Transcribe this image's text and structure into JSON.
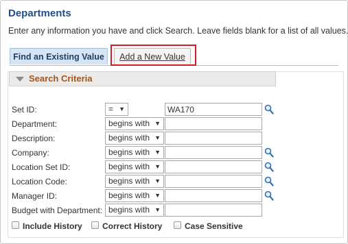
{
  "page": {
    "title": "Departments",
    "instructions": "Enter any information you have and click Search. Leave fields blank for a list of all values."
  },
  "tabs": {
    "find_existing": "Find an Existing Value",
    "add_new": "Add a New Value",
    "active": "find_existing",
    "highlighted": "add_new"
  },
  "search_criteria": {
    "title": "Search Criteria",
    "expanded": true,
    "fields": [
      {
        "label": "Set ID:",
        "operator": "=",
        "value": "WA170",
        "has_lookup": true
      },
      {
        "label": "Department:",
        "operator": "begins with",
        "value": "",
        "has_lookup": false
      },
      {
        "label": "Description:",
        "operator": "begins with",
        "value": "",
        "has_lookup": false
      },
      {
        "label": "Company:",
        "operator": "begins with",
        "value": "",
        "has_lookup": true
      },
      {
        "label": "Location Set ID:",
        "operator": "begins with",
        "value": "",
        "has_lookup": true
      },
      {
        "label": "Location Code:",
        "operator": "begins with",
        "value": "",
        "has_lookup": true
      },
      {
        "label": "Manager ID:",
        "operator": "begins with",
        "value": "",
        "has_lookup": true
      },
      {
        "label": "Budget with Department:",
        "operator": "begins with",
        "value": "",
        "has_lookup": false
      }
    ],
    "options": [
      {
        "label": "Include History",
        "checked": false
      },
      {
        "label": "Correct History",
        "checked": false
      },
      {
        "label": "Case Sensitive",
        "checked": false
      }
    ]
  },
  "icons": {
    "lookup": "magnifier-icon",
    "collapse": "triangle-down-icon",
    "dropdown": "chevron-down-icon"
  },
  "colors": {
    "title": "#1f4e8c",
    "section_header_text": "#a3561b",
    "active_tab_bg": "#d6e5f3",
    "highlight_box": "#d11e26"
  }
}
